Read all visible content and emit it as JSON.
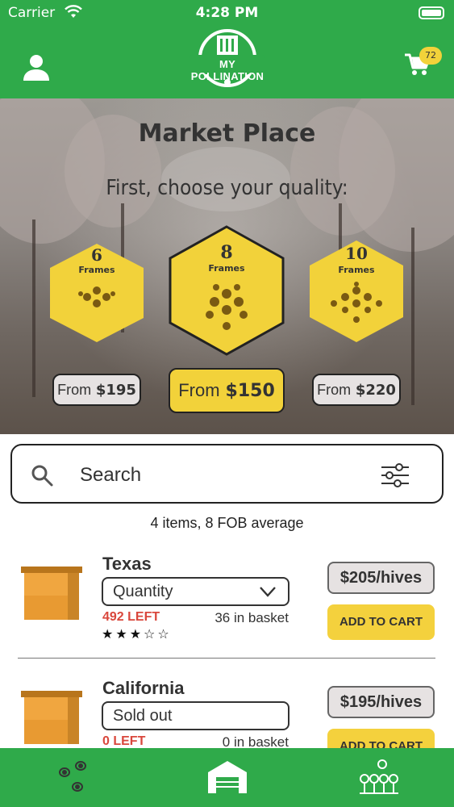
{
  "status_bar": {
    "carrier": "Carrier",
    "time": "4:28 PM"
  },
  "header": {
    "logo_text": "MY POLLINATION",
    "user_icon": "user-icon",
    "cart_icon": "cart-icon",
    "cart_count": "72",
    "brand_color": "#2faa4a"
  },
  "hero": {
    "title": "Market Place",
    "subtitle": "First, choose your quality:",
    "options": [
      {
        "number": "6",
        "unit": "Frames",
        "from_label": "From",
        "price": "$195",
        "selected": false
      },
      {
        "number": "8",
        "unit": "Frames",
        "from_label": "From",
        "price": "$150",
        "selected": true
      },
      {
        "number": "10",
        "unit": "Frames",
        "from_label": "From",
        "price": "$220",
        "selected": false
      }
    ],
    "hex_color": "#f2d23a"
  },
  "search": {
    "placeholder": "Search",
    "value": ""
  },
  "summary": "4 items, 8 FOB average",
  "products": [
    {
      "name": "Texas",
      "quantity_label": "Quantity",
      "left": "492 LEFT",
      "basket": "36 in basket",
      "rating": 3,
      "rating_max": 5,
      "stars": "★★★☆☆",
      "price": "$205/hives",
      "cart_label": "ADD TO CART"
    },
    {
      "name": "California",
      "quantity_label": "Sold out",
      "left": "0 LEFT",
      "basket": "0 in basket",
      "price": "$195/hives",
      "cart_label": "ADD TO CART"
    }
  ],
  "bottom_nav": [
    {
      "icon": "bees-icon"
    },
    {
      "icon": "warehouse-icon"
    },
    {
      "icon": "orchard-icon"
    }
  ]
}
